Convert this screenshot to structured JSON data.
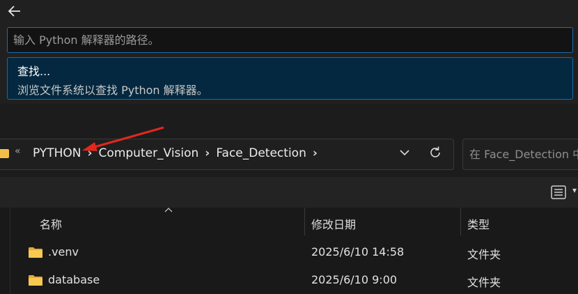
{
  "quick_pick": {
    "input_placeholder": "输入 Python 解释器的路径。",
    "item_title": "查找...",
    "item_description": "浏览文件系统以查找 Python 解释器。"
  },
  "explorer": {
    "breadcrumb_lead": "«",
    "breadcrumbs": [
      "PYTHON",
      "Computer_Vision",
      "Face_Detection"
    ],
    "breadcrumb_separator": "›",
    "search_placeholder": "在 Face_Detection 中",
    "columns": {
      "name": "名称",
      "date": "修改日期",
      "type": "类型"
    },
    "rows": [
      {
        "name": ".venv",
        "date": "2025/6/10 14:58",
        "type": "文件夹"
      },
      {
        "name": "database",
        "date": "2025/6/10 9:00",
        "type": "文件夹"
      }
    ]
  },
  "colors": {
    "accent": "#1a6fb5",
    "folder": "#f2c04a",
    "annotation_arrow": "#e0281e"
  }
}
